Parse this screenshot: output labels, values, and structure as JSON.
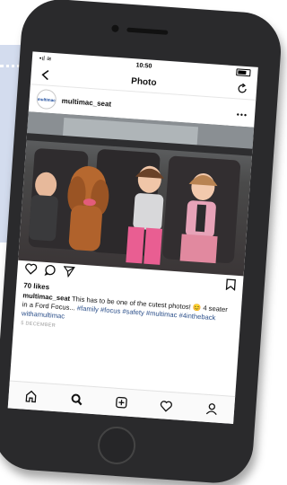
{
  "status_bar": {
    "time": "10:50"
  },
  "nav": {
    "title": "Photo"
  },
  "post": {
    "avatar_text": "multimac",
    "username": "multimac_seat",
    "likes": "70 likes",
    "caption_user": "multimac_seat",
    "caption_text": "This has to be one of the cutest photos! 😊 4 seater in a Ford Focus...",
    "caption_tags": "#family #focus #safety #multimac #4intheback withamultimac",
    "date": "5 DECEMBER"
  },
  "colors": {
    "accent": "#2b4f8a",
    "panel": "#d3dcee",
    "phone_body": "#2a2a2c"
  }
}
